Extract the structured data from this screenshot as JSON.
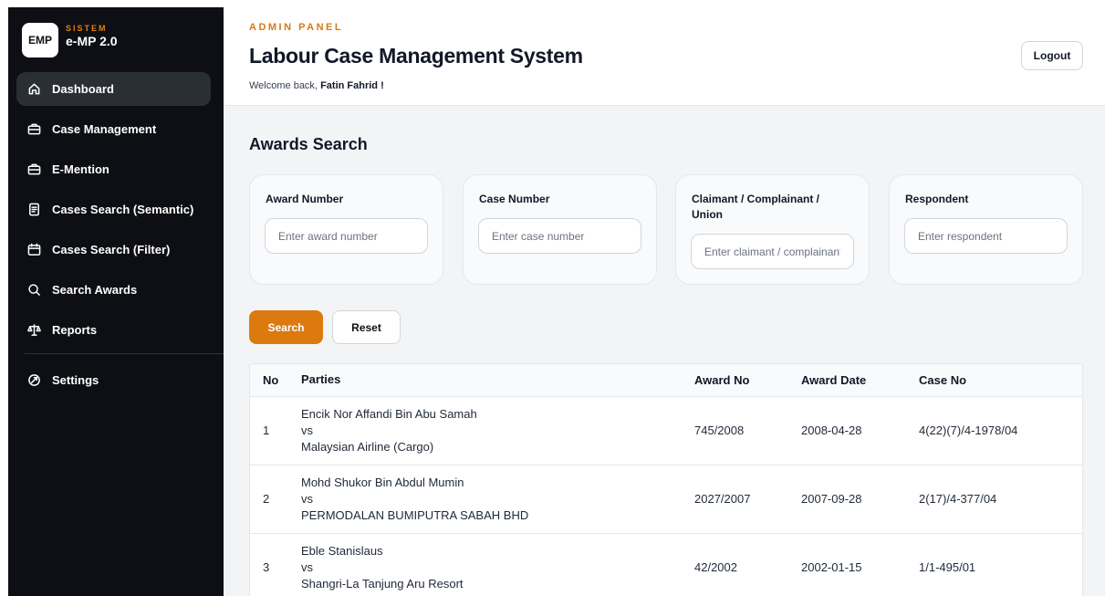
{
  "brand": {
    "logo": "EMP",
    "small_label": "SISTEM",
    "name": "e-MP 2.0"
  },
  "sidebar": {
    "items": [
      {
        "label": "Dashboard",
        "icon": "home-icon",
        "active": true
      },
      {
        "label": "Case Management",
        "icon": "briefcase-icon",
        "active": false
      },
      {
        "label": "E-Mention",
        "icon": "briefcase-icon",
        "active": false
      },
      {
        "label": "Cases Search (Semantic)",
        "icon": "document-icon",
        "active": false
      },
      {
        "label": "Cases Search (Filter)",
        "icon": "calendar-icon",
        "active": false
      },
      {
        "label": "Search Awards",
        "icon": "search-icon",
        "active": false
      },
      {
        "label": "Reports",
        "icon": "scale-icon",
        "active": false
      }
    ],
    "settings": {
      "label": "Settings",
      "icon": "settings-icon"
    }
  },
  "header": {
    "admin_label": "ADMIN PANEL",
    "title": "Labour Case Management System",
    "welcome_prefix": "Welcome back,",
    "user_name": "Fatin Fahrid !",
    "logout_label": "Logout"
  },
  "awards_search": {
    "title": "Awards Search",
    "fields": [
      {
        "label": "Award Number",
        "placeholder": "Enter award number",
        "value": ""
      },
      {
        "label": "Case Number",
        "placeholder": "Enter case number",
        "value": ""
      },
      {
        "label": "Claimant / Complainant / Union",
        "placeholder": "Enter claimant / complainant / union",
        "value": ""
      },
      {
        "label": "Respondent",
        "placeholder": "Enter respondent",
        "value": ""
      }
    ],
    "search_label": "Search",
    "reset_label": "Reset"
  },
  "results": {
    "columns": [
      "No",
      "Parties",
      "Award No",
      "Award Date",
      "Case No"
    ],
    "rows": [
      {
        "no": "1",
        "claimant": "Encik Nor Affandi Bin Abu Samah",
        "vs": "vs",
        "respondent": "Malaysian Airline (Cargo)",
        "award_no": "745/2008",
        "award_date": "2008-04-28",
        "case_no": "4(22)(7)/4-1978/04"
      },
      {
        "no": "2",
        "claimant": "Mohd Shukor Bin Abdul Mumin",
        "vs": "vs",
        "respondent": "PERMODALAN BUMIPUTRA SABAH BHD",
        "award_no": "2027/2007",
        "award_date": "2007-09-28",
        "case_no": "2(17)/4-377/04"
      },
      {
        "no": "3",
        "claimant": "Eble Stanislaus",
        "vs": "vs",
        "respondent": "Shangri-La Tanjung Aru Resort",
        "award_no": "42/2002",
        "award_date": "2002-01-15",
        "case_no": "1/1-495/01"
      }
    ]
  },
  "colors": {
    "accent": "#dc7a10",
    "sidebar_bg": "#0d0f14",
    "sidebar_active": "#2a2e35",
    "main_bg": "#f3f4f6"
  }
}
